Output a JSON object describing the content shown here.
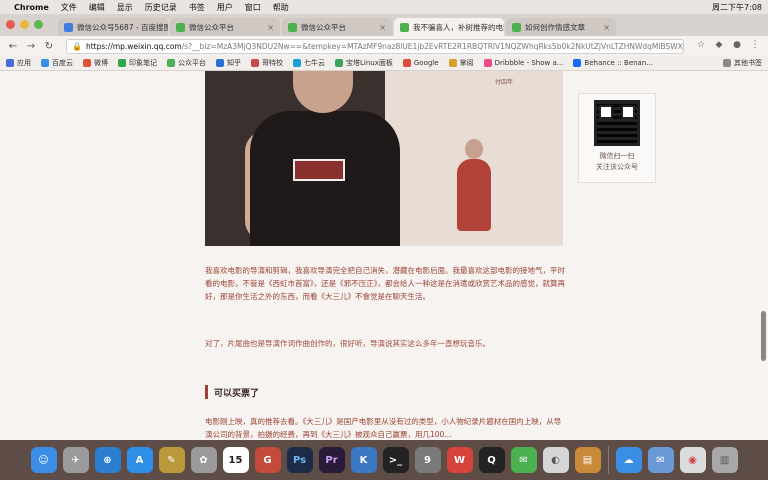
{
  "menubar": {
    "apple": "",
    "items": [
      "Chrome",
      "文件",
      "编辑",
      "显示",
      "历史记录",
      "书签",
      "用户",
      "窗口",
      "帮助"
    ],
    "clock": "周二下午7:08"
  },
  "tabs": [
    {
      "title": "微信公众号5687 - 百度搜图",
      "color": "#3f7be0"
    },
    {
      "title": "微信公众平台",
      "color": "#4caf50"
    },
    {
      "title": "微信公众平台",
      "color": "#4caf50"
    },
    {
      "title": "我不骗喜人，补树推荐的电影",
      "color": "#4caf50"
    },
    {
      "title": "如何创作情感文章",
      "color": "#4caf50"
    }
  ],
  "addressbar": {
    "host": "https://mp.weixin.qq.com",
    "path": "/s?__biz=MzA3MjQ3NDU2Nw==&tempkey=MTAzMF9naz8lUE1jb2EvRTE2R1RBQTRlV1NQZWhqRks5b0k2NkUtZjVnLTZHNWdqMlBSWXJYYEhM1pv..."
  },
  "bookmarks": [
    {
      "label": "应用",
      "color": "#4a6ad8"
    },
    {
      "label": "百度云",
      "color": "#3a8ee6"
    },
    {
      "label": "微博",
      "color": "#e0523a"
    },
    {
      "label": "印象笔记",
      "color": "#2ea84a"
    },
    {
      "label": "公众平台",
      "color": "#4caf50"
    },
    {
      "label": "知乎",
      "color": "#2a6fd6"
    },
    {
      "label": "哥特校",
      "color": "#c94a4a"
    },
    {
      "label": "七牛云",
      "color": "#19a0d8"
    },
    {
      "label": "宝塔Linux面板",
      "color": "#3aa658"
    },
    {
      "label": "Google",
      "color": "#e04a3a"
    },
    {
      "label": "掌阅",
      "color": "#d6a12a"
    },
    {
      "label": "Dribbble - Show a...",
      "color": "#ea4c89"
    },
    {
      "label": "Behance :: Benan...",
      "color": "#1769ff"
    }
  ],
  "bookmarks_other": "其他书签",
  "image": {
    "sign_text": "付四年"
  },
  "qr": {
    "line1": "微信扫一扫",
    "line2": "关注该公众号"
  },
  "article": {
    "p1": "我喜欢电影的导演和剪辑，我喜欢导演完全把自己消失，潜藏在电影后面。我最喜欢这部电影的接地气，平时看的电影，不管是《西虹市首富》，还是《邪不压正》，都会给人一种这是在消遣或欣赏艺术品的感觉，就算再好，那是你生活之外的东西，而看《大三儿》不會觉是在聊天生活。",
    "p2": "对了，片尾曲也是导演作词作曲创作的，很好听，导演说其实这么多年一直想玩音乐。",
    "section_title": "可以买票了",
    "p4": "电影刚上映，真的推荐去看。《大三儿》是国产电影里从没有过的类型，小人物纪录片题材在国内上映，从导演公司的背景，拍摄的经费，再到《大三儿》被观众自己赢票，用几100..."
  },
  "dock": [
    {
      "name": "finder",
      "color": "#3a8ee6",
      "glyph": "☺"
    },
    {
      "name": "launchpad",
      "color": "#9a9a9a",
      "glyph": "🚀"
    },
    {
      "name": "safari",
      "color": "#2b7fd1",
      "glyph": "⊕"
    },
    {
      "name": "appstore",
      "color": "#2e8fe8",
      "glyph": "A"
    },
    {
      "name": "notes",
      "color": "#e5c04a",
      "glyph": "✎"
    },
    {
      "name": "photos",
      "color": "#b3b3b3",
      "glyph": "✿"
    },
    {
      "name": "calendar",
      "color": "#ffffff",
      "glyph": "15"
    },
    {
      "name": "app-g",
      "color": "#c44a3a",
      "glyph": "G"
    },
    {
      "name": "photoshop",
      "color": "#1c2c46",
      "glyph": "Ps"
    },
    {
      "name": "sep1",
      "color": "",
      "glyph": ""
    },
    {
      "name": "premiere",
      "color": "#2a1a3a",
      "glyph": "Pr"
    },
    {
      "name": "keynote",
      "color": "#3a78c4",
      "glyph": "K"
    },
    {
      "name": "terminal",
      "color": "#222222",
      "glyph": ">_"
    },
    {
      "name": "app-9",
      "color": "#7a7a7a",
      "glyph": "9"
    },
    {
      "name": "wps",
      "color": "#d6433a",
      "glyph": "W"
    },
    {
      "name": "qq",
      "color": "#222222",
      "glyph": "Q"
    },
    {
      "name": "wechat",
      "color": "#4caf50",
      "glyph": "✉"
    },
    {
      "name": "wecom",
      "color": "#d6d6d6",
      "glyph": "◐"
    },
    {
      "name": "books",
      "color": "#c98a3a",
      "glyph": "▤"
    },
    {
      "name": "sep2",
      "color": "",
      "glyph": ""
    },
    {
      "name": "baidu-netdisk",
      "color": "#3a8ee6",
      "glyph": "☁"
    },
    {
      "name": "mail",
      "color": "#6a9ad6",
      "glyph": "✉"
    },
    {
      "name": "chrome",
      "color": "#dcdcdc",
      "glyph": "◉"
    },
    {
      "name": "trash",
      "color": "#a8a8a8",
      "glyph": "🗑"
    }
  ]
}
